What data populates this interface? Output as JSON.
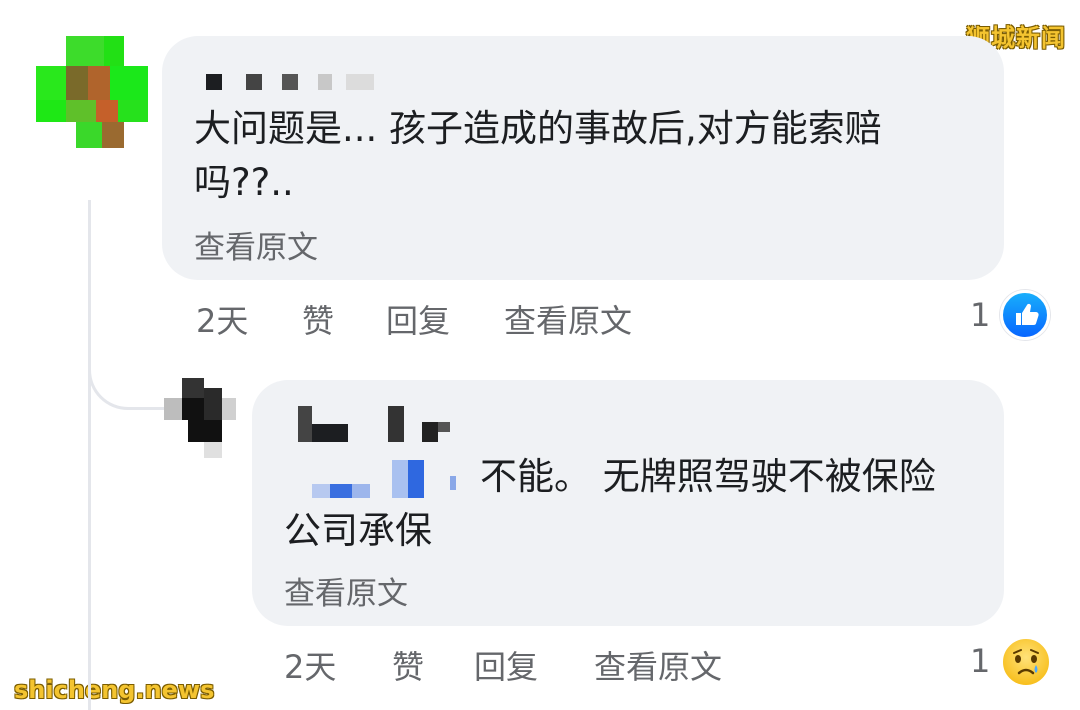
{
  "watermarks": {
    "top_right": "狮城新闻",
    "bottom_left": "shicheng.news"
  },
  "comment1": {
    "text_line1": "大问题是... 孩子造成的事故后,对方能索赔",
    "text_line2": "吗??..",
    "see_original": "查看原文",
    "actions": {
      "time": "2天",
      "like": "赞",
      "reply": "回复",
      "see_original": "查看原文"
    },
    "reaction_count": "1",
    "reaction_icon": "like-icon"
  },
  "comment2": {
    "text_line1": "不能。 无牌照驾驶不被保险",
    "text_line2": "公司承保",
    "see_original": "查看原文",
    "actions": {
      "time": "2天",
      "like": "赞",
      "reply": "回复",
      "see_original": "查看原文"
    },
    "reaction_count": "1",
    "reaction_icon": "sad-icon"
  },
  "colors": {
    "bubble": "#f0f2f5",
    "secondary_text": "#65676b",
    "like_blue": "#0866ff",
    "watermark": "#f4c430"
  }
}
